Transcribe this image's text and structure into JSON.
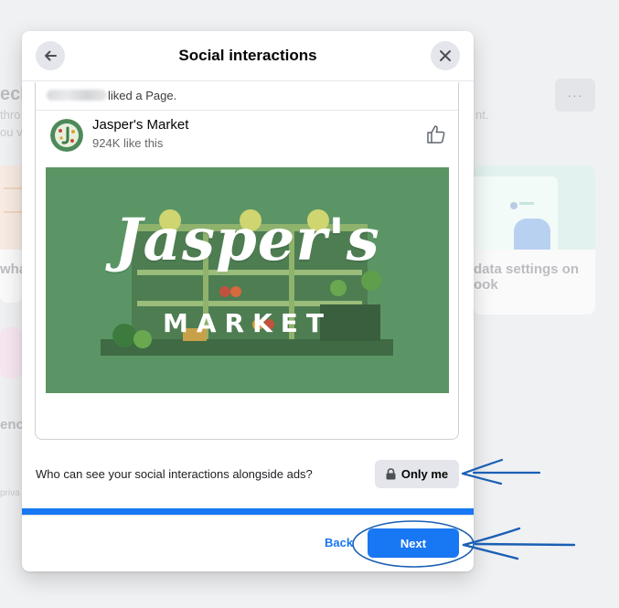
{
  "background": {
    "frag_checkup": "ecl",
    "frag_thro": "thro",
    "frag_you": "ou v",
    "frag_nt": "nt.",
    "frag_what": "wha",
    "frag_data_settings_1": "data settings on",
    "frag_data_settings_2": "ook",
    "frag_enc": "enc",
    "frag_priv": "priva",
    "more_label": "···"
  },
  "modal": {
    "title": "Social interactions",
    "back_icon": "arrow-left-icon",
    "close_icon": "close-icon",
    "activity_text": "liked a Page.",
    "page": {
      "name": "Jasper's Market",
      "likes": "924K like this",
      "cover_title": "Jasper's",
      "cover_subtitle": "MARKET"
    },
    "question": "Who can see your social interactions alongside ads?",
    "audience_button": "Only me",
    "back_label": "Back",
    "next_label": "Next"
  },
  "colors": {
    "accent": "#1877f2",
    "cover_green": "#5b9565",
    "annotation_blue": "#1a5fb4"
  }
}
